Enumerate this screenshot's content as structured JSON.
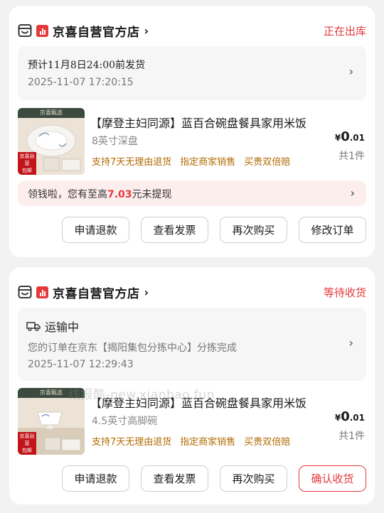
{
  "orders": [
    {
      "shop_name": "京喜自营官方店",
      "status": "正在出库",
      "info_line1": "预计11月8日24:00前发货",
      "info_line2": "2025-11-07 17:20:15",
      "product": {
        "title": "【摩登主妇同源】蓝百合碗盘餐具家用米饭",
        "spec": "8英寸深盘",
        "tags": [
          "支持7天无理由退货",
          "指定商家销售",
          "买贵双倍赔"
        ],
        "price_symbol": "¥",
        "price_int": "0",
        "price_dec": ".01",
        "qty": "共1件",
        "thumb_brand": "京喜甄选",
        "thumb_tag1": "京喜自营",
        "thumb_tag2": "包邮"
      },
      "cash": {
        "prefix": "领钱啦，您有至高",
        "amount": "7.03",
        "suffix": "元未提现"
      },
      "buttons": [
        "申请退款",
        "查看发票",
        "再次购买",
        "修改订单"
      ]
    },
    {
      "shop_name": "京喜自营官方店",
      "status": "等待收货",
      "ship_title": "运输中",
      "ship_desc": "您的订单在京东【揭阳集包分拣中心】分拣完成",
      "ship_time": "2025-11-07 12:29:43",
      "product": {
        "title": "【摩登主妇同源】蓝百合碗盘餐具家用米饭",
        "spec": "4.5英寸高脚碗",
        "tags": [
          "支持7天无理由退货",
          "指定商家销售",
          "买贵双倍赔"
        ],
        "price_symbol": "¥",
        "price_int": "0",
        "price_dec": ".01",
        "qty": "共1件",
        "thumb_brand": "京喜甄选",
        "thumb_tag1": "京喜自营",
        "thumb_tag2": "包邮"
      },
      "buttons": [
        "申请退款",
        "查看发票",
        "再次购买",
        "确认收货"
      ]
    }
  ],
  "watermark": "线报酷-new.xianbao.fun",
  "colors": {
    "accent": "#e4393c",
    "tag_text": "#b36a00",
    "cash_bg": "#fdeeee",
    "page_bg": "#f2f2f2"
  },
  "icons": {
    "shop": "store-icon",
    "brand": "jx-brand-icon",
    "chevron": "chevron-right-icon",
    "truck": "truck-icon"
  }
}
